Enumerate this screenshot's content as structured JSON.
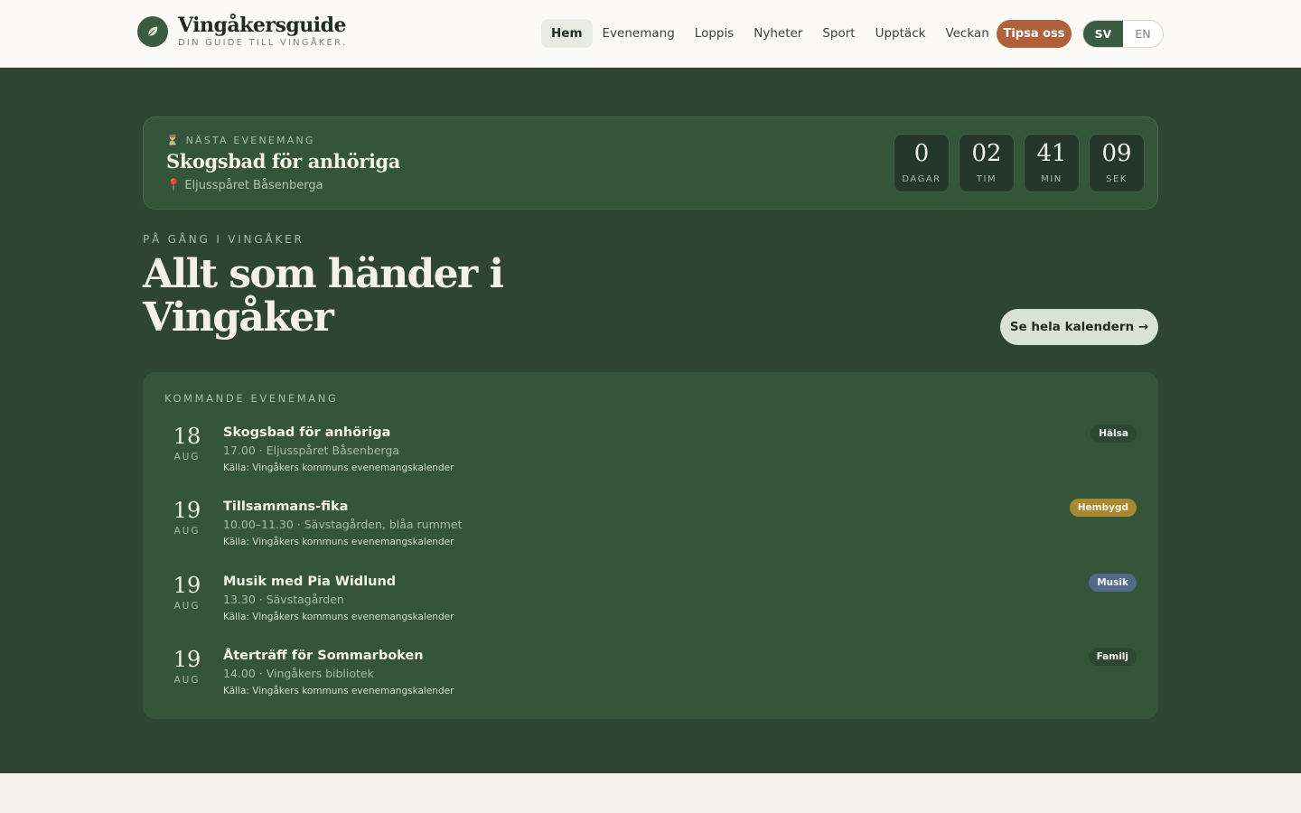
{
  "brand": {
    "name": "Vingåkersguide",
    "tagline": "DIN GUIDE TILL VINGÅKER."
  },
  "nav": [
    {
      "label": "Hem",
      "active": true
    },
    {
      "label": "Evenemang"
    },
    {
      "label": "Loppis"
    },
    {
      "label": "Nyheter"
    },
    {
      "label": "Sport"
    },
    {
      "label": "Upptäck"
    },
    {
      "label": "Veckan"
    }
  ],
  "header": {
    "tip_label": "Tipsa oss",
    "lang_sv": "SV",
    "lang_en": "EN"
  },
  "next_event": {
    "kicker": "NÄSTA EVENEMANG",
    "title": "Skogsbad för anhöriga",
    "place": "Eljusspåret Båsenberga",
    "countdown": [
      {
        "value": "0",
        "label": "DAGAR"
      },
      {
        "value": "02",
        "label": "TIM"
      },
      {
        "value": "41",
        "label": "MIN"
      },
      {
        "value": "09",
        "label": "SEK"
      }
    ]
  },
  "hero": {
    "kicker": "PÅ GÅNG I VINGÅKER",
    "title": "Allt som händer i Vingåker",
    "calendar_button": "Se hela kalendern →"
  },
  "events": {
    "heading": "KOMMANDE EVENEMANG",
    "items": [
      {
        "day": "18",
        "month": "AUG",
        "title": "Skogsbad för anhöriga",
        "meta": "17.00 · Eljusspåret Båsenberga",
        "source": "Källa: Vingåkers kommuns evenemangskalender",
        "badge": "Hälsa",
        "badge_color": "#2e4634"
      },
      {
        "day": "19",
        "month": "AUG",
        "title": "Tillsammans-fika",
        "meta": "10.00–11.30 · Sävstagården, blåa rummet",
        "source": "Källa: Vingåkers kommuns evenemangskalender",
        "badge": "Hembygd",
        "badge_color": "#a9882f"
      },
      {
        "day": "19",
        "month": "AUG",
        "title": "Musik med Pia Widlund",
        "meta": "13.30 · Sävstagården",
        "source": "Källa: Vingåkers kommuns evenemangskalender",
        "badge": "Musik",
        "badge_color": "#4f6b88"
      },
      {
        "day": "19",
        "month": "AUG",
        "title": "Återträff för Sommarboken",
        "meta": "14.00 · Vingåkers bibliotek",
        "source": "Källa: Vingåkers kommuns evenemangskalender",
        "badge": "Familj",
        "badge_color": "#2e4634"
      }
    ]
  }
}
